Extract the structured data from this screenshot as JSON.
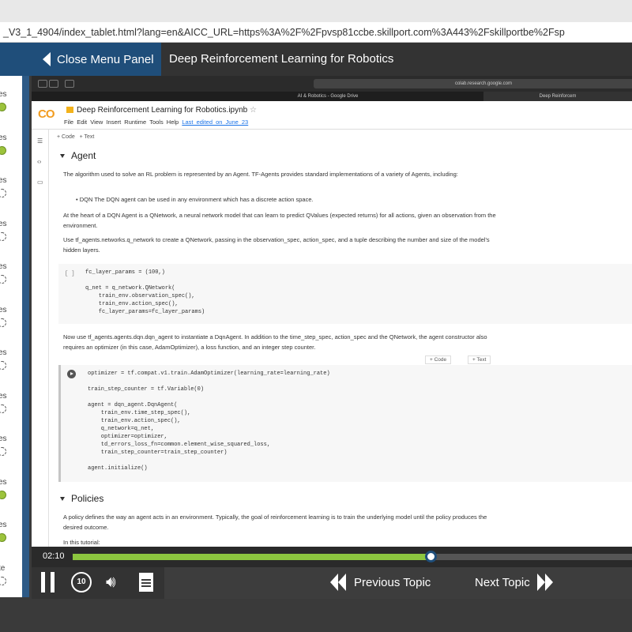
{
  "browser": {
    "url": "_V3_1_4904/index_tablet.html?lang=en&AICC_URL=https%3A%2F%2Fpvsp81ccbe.skillport.com%3A443%2Fskillportbe%2Fsp"
  },
  "header": {
    "close_menu_label": "Close Menu Panel",
    "course_title": "Deep Reinforcement Learning for Robotics"
  },
  "sidebar": {
    "items": [
      {
        "label": "es",
        "status": "done"
      },
      {
        "label": "es",
        "status": "done"
      },
      {
        "label": "es",
        "status": "todo"
      },
      {
        "label": "es",
        "status": "todo"
      },
      {
        "label": "es",
        "status": "todo"
      },
      {
        "label": "es",
        "status": "todo"
      },
      {
        "label": "es",
        "status": "todo"
      },
      {
        "label": "es",
        "status": "todo"
      },
      {
        "label": "es",
        "status": "todo"
      },
      {
        "label": "es",
        "status": "done"
      },
      {
        "label": "es",
        "status": "done"
      },
      {
        "label": "te",
        "status": "todo"
      },
      {
        "label": "es",
        "status": "todo"
      }
    ]
  },
  "embedded": {
    "url": "colab.research.google.com",
    "tab1": "AI & Robotics - Google Drive",
    "tab2": "Deep Reinforcem",
    "logo": "CO",
    "notebook_title": "Deep Reinforcement Learning for Robotics.ipynb",
    "menu": [
      "File",
      "Edit",
      "View",
      "Insert",
      "Runtime",
      "Tools",
      "Help"
    ],
    "last_edited": "Last edited on June 23",
    "add_code": "+ Code",
    "add_text": "+ Text",
    "section1": "Agent",
    "p1": "The algorithm used to solve an RL problem is represented by an Agent. TF-Agents provides standard implementations of a variety of Agents, including:",
    "bullet": "DQN The DQN agent can be used in any environment which has a discrete action space.",
    "p2": "At the heart of a DQN Agent is a QNetwork, a neural network model that can learn to predict QValues (expected returns) for all actions, given an observation from the environment.",
    "p3": "Use tf_agents.networks.q_network to create a QNetwork, passing in the observation_spec, action_spec, and a tuple describing the number and size of the model's hidden layers.",
    "code1_bracket": "[ ]",
    "code1": "fc_layer_params = (100,)\n\nq_net = q_network.QNetwork(\n    train_env.observation_spec(),\n    train_env.action_spec(),\n    fc_layer_params=fc_layer_params)",
    "p4": "Now use tf_agents.agents.dqn.dqn_agent to instantiate a DqnAgent. In addition to the time_step_spec, action_spec and the QNetwork, the agent constructor also requires an optimizer (in this case, AdamOptimizer), a loss function, and an integer step counter.",
    "cell_add_code": "+ Code",
    "cell_add_text": "+ Text",
    "code2": "optimizer = tf.compat.v1.train.AdamOptimizer(learning_rate=learning_rate)\n\ntrain_step_counter = tf.Variable(0)\n\nagent = dqn_agent.DqnAgent(\n    train_env.time_step_spec(),\n    train_env.action_spec(),\n    q_network=q_net,\n    optimizer=optimizer,\n    td_errors_loss_fn=common.element_wise_squared_loss,\n    train_step_counter=train_step_counter)\n\nagent.initialize()",
    "section2": "Policies",
    "p5": "A policy defines the way an agent acts in an environment. Typically, the goal of reinforcement learning is to train the underlying model until the policy produces the desired outcome.",
    "p6": "In this tutorial:"
  },
  "player": {
    "time": "02:10",
    "progress_fraction": 0.64,
    "replay_label": "10",
    "prev_label": "Previous Topic",
    "next_label": "Next Topic"
  }
}
